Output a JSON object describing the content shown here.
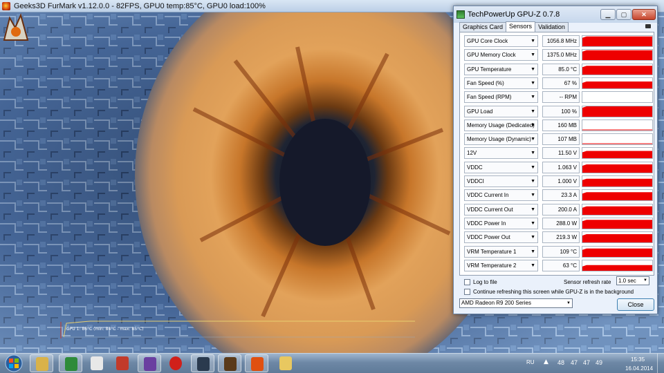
{
  "furmark": {
    "title": "Geeks3D FurMark v1.12.0.0 - 82FPS, GPU0 temp:85°C, GPU0 load:100%",
    "osd_text": "GPU 1: 86°C (min: 84°C - max: 85°C)"
  },
  "gpuz": {
    "title": "TechPowerUp GPU-Z 0.7.8",
    "tabs": [
      "Graphics Card",
      "Sensors",
      "Validation"
    ],
    "active_tab": "Sensors",
    "sensors": [
      {
        "name": "GPU Core Clock",
        "value": "1056.8 MHz",
        "level": 0.95
      },
      {
        "name": "GPU Memory Clock",
        "value": "1375.0 MHz",
        "level": 0.95
      },
      {
        "name": "GPU Temperature",
        "value": "85.0 °C",
        "level": 0.85
      },
      {
        "name": "Fan Speed (%)",
        "value": "67 %",
        "level": 0.67
      },
      {
        "name": "Fan Speed (RPM)",
        "value": "-- RPM",
        "level": 0
      },
      {
        "name": "GPU Load",
        "value": "100 %",
        "level": 1.0
      },
      {
        "name": "Memory Usage (Dedicated)",
        "value": "160 MB",
        "level": 0.05
      },
      {
        "name": "Memory Usage (Dynamic)",
        "value": "107 MB",
        "level": 0.04
      },
      {
        "name": "12V",
        "value": "11.50 V",
        "level": 0.7
      },
      {
        "name": "VDDC",
        "value": "1.063 V",
        "level": 0.8
      },
      {
        "name": "VDDCI",
        "value": "1.000 V",
        "level": 0.75
      },
      {
        "name": "VDDC Current In",
        "value": "23.3 A",
        "level": 0.78
      },
      {
        "name": "VDDC Current Out",
        "value": "200.0 A",
        "level": 0.82
      },
      {
        "name": "VDDC Power In",
        "value": "288.0 W",
        "level": 0.85
      },
      {
        "name": "VDDC Power Out",
        "value": "219.3 W",
        "level": 0.8
      },
      {
        "name": "VRM Temperature 1",
        "value": "109 °C",
        "level": 0.82
      },
      {
        "name": "VRM Temperature 2",
        "value": "63 °C",
        "level": 0.55
      }
    ],
    "log_to_file_label": "Log to file",
    "refresh_label": "Sensor refresh rate",
    "refresh_value": "1.0 sec",
    "continue_label": "Continue refreshing this screen while GPU-Z is in the background",
    "gpu_select": "AMD Radeon R9 200 Series",
    "close_label": "Close",
    "graph_color": "#ee0000"
  },
  "taskbar": {
    "items": [
      "explorer",
      "gpu-tool",
      "settings",
      "media",
      "visual-studio",
      "opera",
      "steam",
      "game-launcher",
      "furmark",
      "file-explorer"
    ],
    "lang": "RU",
    "tray_numbers": [
      "48",
      "47",
      "47",
      "49"
    ],
    "time": "15:35",
    "date": "16.04.2014"
  }
}
